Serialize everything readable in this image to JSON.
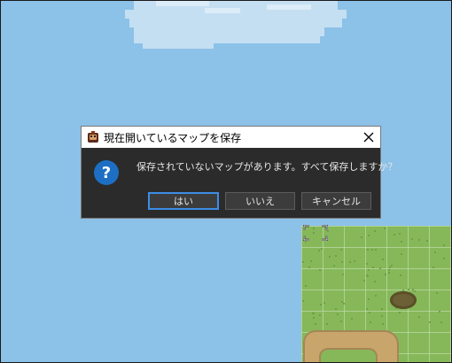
{
  "dialog": {
    "title": "現在開いているマップを保存",
    "message": "保存されていないマップがあります。すべて保存しますか？",
    "buttons": {
      "yes": "はい",
      "no": "いいえ",
      "cancel": "キャンセル"
    },
    "close_glyph": "✕",
    "question_glyph": "?"
  },
  "icons": {
    "app": "app-icon",
    "close": "close-icon",
    "question": "question-icon",
    "selection": "selection-bracket-icon"
  },
  "colors": {
    "sky": "#8cc1e8",
    "grass": "#86b85a",
    "dialog_bg": "#2b2b2b",
    "focus_accent": "#3d8ee6",
    "question_blue": "#1d6fc4"
  }
}
